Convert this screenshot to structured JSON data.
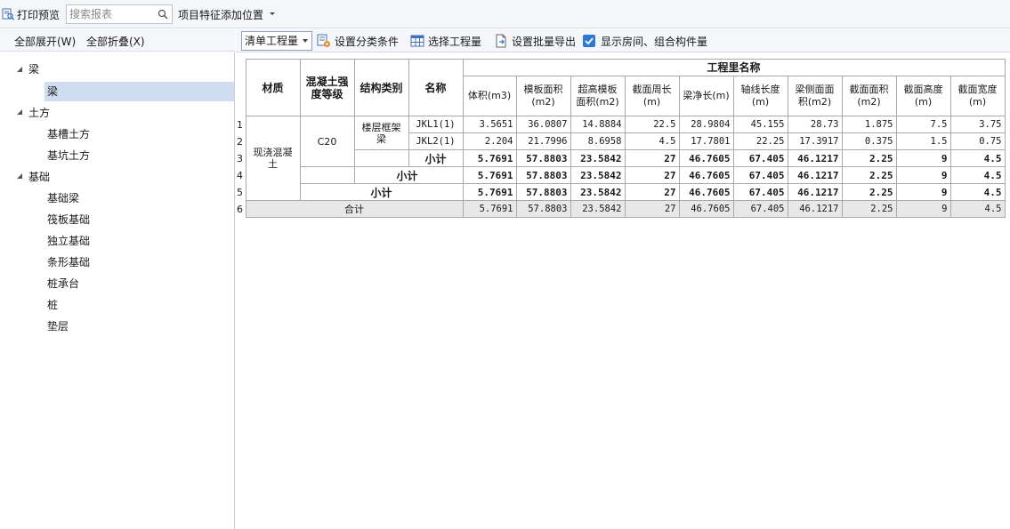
{
  "toolbar": {
    "print_preview": "打印预览",
    "search_placeholder": "搜索报表",
    "feature_position": "项目特征添加位置"
  },
  "left_panel": {
    "expand_all": "全部展开(W)",
    "collapse_all": "全部折叠(X)",
    "tree": [
      {
        "label": "梁",
        "level": 0
      },
      {
        "label": "梁",
        "level": 1,
        "selected": true
      },
      {
        "label": "土方",
        "level": 0
      },
      {
        "label": "基槽土方",
        "level": 1
      },
      {
        "label": "基坑土方",
        "level": 1
      },
      {
        "label": "基础",
        "level": 0
      },
      {
        "label": "基础梁",
        "level": 1
      },
      {
        "label": "筏板基础",
        "level": 1
      },
      {
        "label": "独立基础",
        "level": 1
      },
      {
        "label": "条形基础",
        "level": 1
      },
      {
        "label": "桩承台",
        "level": 1
      },
      {
        "label": "桩",
        "level": 1
      },
      {
        "label": "垫层",
        "level": 1
      }
    ]
  },
  "right_toolbar": {
    "quantity_type": "清单工程量",
    "set_category": "设置分类条件",
    "select_quantity": "选择工程量",
    "batch_export": "设置批量导出",
    "show_rooms": "显示房间、组合构件量"
  },
  "table": {
    "headers": {
      "material": "材质",
      "grade": "混凝土强度等级",
      "struct_type": "结构类别",
      "name": "名称",
      "group": "工程里名称"
    },
    "sub_headers": [
      "体积(m3)",
      "模板面积(m2)",
      "超高模板面积(m2)",
      "截面周长(m)",
      "梁净长(m)",
      "轴线长度(m)",
      "梁侧面面积(m2)",
      "截面面积(m2)",
      "截面高度(m)",
      "截面宽度(m)"
    ],
    "row_numbers": [
      "1",
      "2",
      "3",
      "4",
      "5",
      "6"
    ],
    "material": "现浇混凝土",
    "grade": "C20",
    "struct_type": "楼层框架梁",
    "subtotal_label": "小计",
    "total_label": "合计",
    "rows": [
      {
        "name": "JKL1(1)",
        "values": [
          "3.5651",
          "36.0807",
          "14.8884",
          "22.5",
          "28.9804",
          "45.155",
          "28.73",
          "1.875",
          "7.5",
          "3.75"
        ]
      },
      {
        "name": "JKL2(1)",
        "values": [
          "2.204",
          "21.7996",
          "8.6958",
          "4.5",
          "17.7801",
          "22.25",
          "17.3917",
          "0.375",
          "1.5",
          "0.75"
        ]
      }
    ],
    "subtotal_values": [
      "5.7691",
      "57.8803",
      "23.5842",
      "27",
      "46.7605",
      "67.405",
      "46.1217",
      "2.25",
      "9",
      "4.5"
    ],
    "total_values": [
      "5.7691",
      "57.8803",
      "23.5842",
      "27",
      "46.7605",
      "67.405",
      "46.1217",
      "2.25",
      "9",
      "4.5"
    ]
  },
  "colors": {
    "accent": "#2d7ad6",
    "selection": "#cfdcf2",
    "toolbar_bg": "#f4f6f9",
    "total_row_bg": "#e8e8e8"
  }
}
